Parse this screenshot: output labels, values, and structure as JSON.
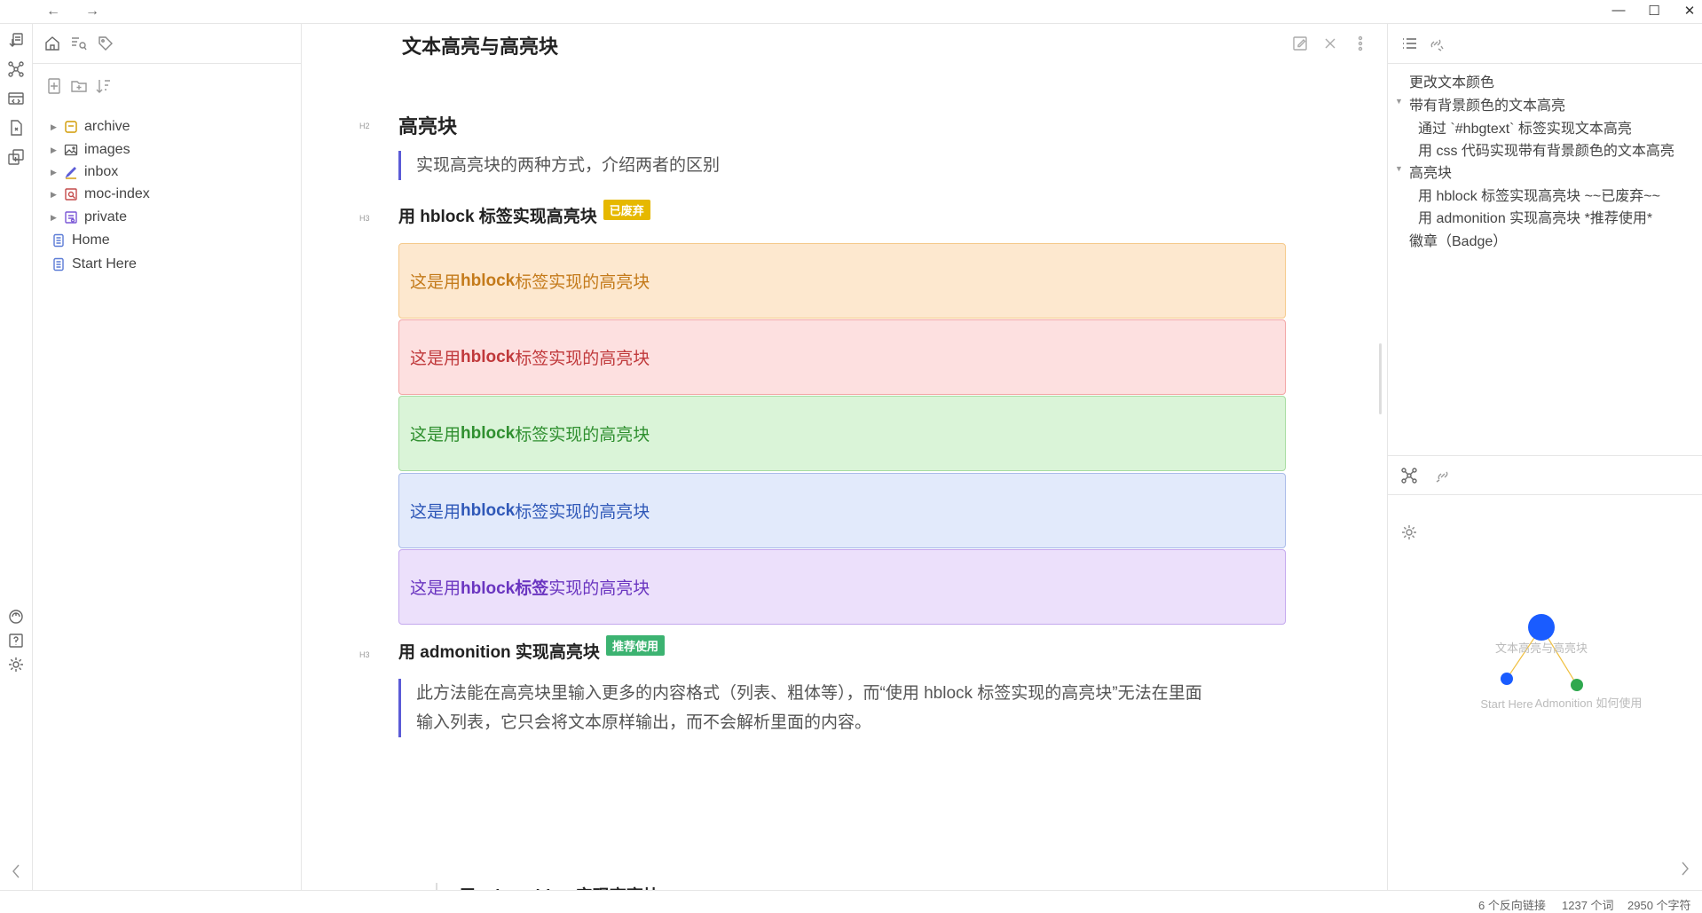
{
  "titlebar": {
    "back_icon": "arrow-left-icon",
    "forward_icon": "arrow-right-icon",
    "minimize": "—",
    "maximize": "☐",
    "close": "✕"
  },
  "ribbon": {
    "icons": [
      "open-quick-switcher-icon",
      "graph-view-icon",
      "canvas-icon",
      "daily-note-icon",
      "templates-icon",
      "vault-switch-icon",
      "help-icon",
      "settings-icon",
      "collapse-icon"
    ]
  },
  "file_tree": {
    "folders": [
      {
        "label": "archive",
        "icon": "archive-folder-icon",
        "color": "#d19a00"
      },
      {
        "label": "images",
        "icon": "images-folder-icon",
        "color": "#555555"
      },
      {
        "label": "inbox",
        "icon": "inbox-folder-icon",
        "color": "#5b5bd6"
      },
      {
        "label": "moc-index",
        "icon": "moc-folder-icon",
        "color": "#c44a4a"
      },
      {
        "label": "private",
        "icon": "private-folder-icon",
        "color": "#7a56d6"
      }
    ],
    "files": [
      {
        "label": "Home",
        "icon": "note-icon"
      },
      {
        "label": "Start Here",
        "icon": "note-icon"
      }
    ]
  },
  "document": {
    "title": "文本高亮与高亮块",
    "h2": {
      "label": "H2",
      "text": "高亮块"
    },
    "intro_quote": "实现高亮块的两种方式，介绍两者的区别",
    "section1": {
      "label": "H3",
      "text": "用 hblock 标签实现高亮块",
      "badge": "已废弃",
      "badge_color": "#e6b800"
    },
    "hblocks": [
      {
        "prefix": "这是用",
        "bold": "hblock",
        "suffix": "标签实现的高亮块",
        "bg": "#fde8cf",
        "border": "#f5c98a",
        "color": "#c47a1a"
      },
      {
        "prefix": "这是用",
        "bold": "hblock",
        "suffix": "标签实现的高亮块",
        "bg": "#fde0e0",
        "border": "#f2a4a4",
        "color": "#c0393b"
      },
      {
        "prefix": "这是用",
        "bold": "hblock",
        "suffix": "标签实现的高亮块",
        "bg": "#daf4d8",
        "border": "#a6dca0",
        "color": "#2f8f2f"
      },
      {
        "prefix": "这是用",
        "bold": "hblock",
        "suffix": "标签实现的高亮块",
        "bg": "#e2eafb",
        "border": "#a9bbe9",
        "color": "#2f58b8"
      },
      {
        "prefix": "这是用",
        "bold": "hblock标签",
        "suffix": "实现的高亮块",
        "bg": "#ece0fb",
        "border": "#c4a8ee",
        "color": "#6a35c0"
      }
    ],
    "section2": {
      "label": "H3",
      "text": "用 admonition 实现高亮块",
      "badge": "推荐使用",
      "badge_color": "#3cb371"
    },
    "section2_quote_line1": "此方法能在高亮块里输入更多的内容格式（列表、粗体等），而“使用 hblock 标签实现的高亮块”无法在里面",
    "section2_quote_line2": "输入列表，它只会将文本原样输出，而不会解析里面的内容。",
    "nested_heading": "用 admonition 实现高亮块"
  },
  "outline": {
    "items": [
      {
        "text": "更改文本颜色",
        "level": 1,
        "caret": false
      },
      {
        "text": "带有背景颜色的文本高亮",
        "level": 1,
        "caret": true
      },
      {
        "text": "通过 `#hbgtext` 标签实现文本高亮",
        "level": 2,
        "caret": false
      },
      {
        "text": "用 css 代码实现带有背景颜色的文本高亮",
        "level": 2,
        "caret": false
      },
      {
        "text": "高亮块",
        "level": 1,
        "caret": true
      },
      {
        "text": "用 hblock 标签实现高亮块 ~~已废弃~~",
        "level": 2,
        "caret": false
      },
      {
        "text": "用 admonition 实现高亮块 *推荐使用*",
        "level": 2,
        "caret": false
      },
      {
        "text": "徽章（Badge）",
        "level": 1,
        "caret": false
      }
    ]
  },
  "graph": {
    "nodes": [
      {
        "label": "文本高亮与高亮块",
        "color": "#1a5cff"
      },
      {
        "label": "Start Here",
        "color": "#1a5cff"
      },
      {
        "label": "Admonition 如何使用",
        "color": "#2fa84f"
      }
    ],
    "edge_color": "#f0c040"
  },
  "status": {
    "backlinks": "6 个反向链接",
    "words": "1237 个词",
    "chars": "2950 个字符"
  }
}
